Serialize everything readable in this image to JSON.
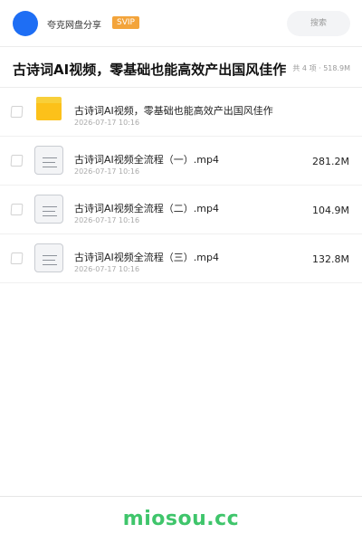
{
  "header": {
    "app_name": "夸克网盘分享",
    "badge": "SVIP",
    "search_placeholder": "搜索"
  },
  "share": {
    "title": "古诗词AI视频，零基础也能高效产出国风佳作",
    "meta": "共 4 项 · 518.9M"
  },
  "files": [
    {
      "type": "folder",
      "icon": "folder-icon",
      "name": "古诗词AI视频，零基础也能高效产出国风佳作",
      "date": "2026-07-17 10:16",
      "size": ""
    },
    {
      "type": "video",
      "icon": "document-icon",
      "name": "古诗词AI视频全流程（一）.mp4",
      "date": "2026-07-17 10:16",
      "size": "281.2M"
    },
    {
      "type": "video",
      "icon": "document-icon",
      "name": "古诗词AI视频全流程（二）.mp4",
      "date": "2026-07-17 10:16",
      "size": "104.9M"
    },
    {
      "type": "video",
      "icon": "document-icon",
      "name": "古诗词AI视频全流程（三）.mp4",
      "date": "2026-07-17 10:16",
      "size": "132.8M"
    }
  ],
  "watermark": "miosou.cc",
  "colors": {
    "avatar": "#1e6ef4",
    "badge": "#f3a43b",
    "folder": "#fcc11a",
    "watermark": "#3fc56b"
  }
}
